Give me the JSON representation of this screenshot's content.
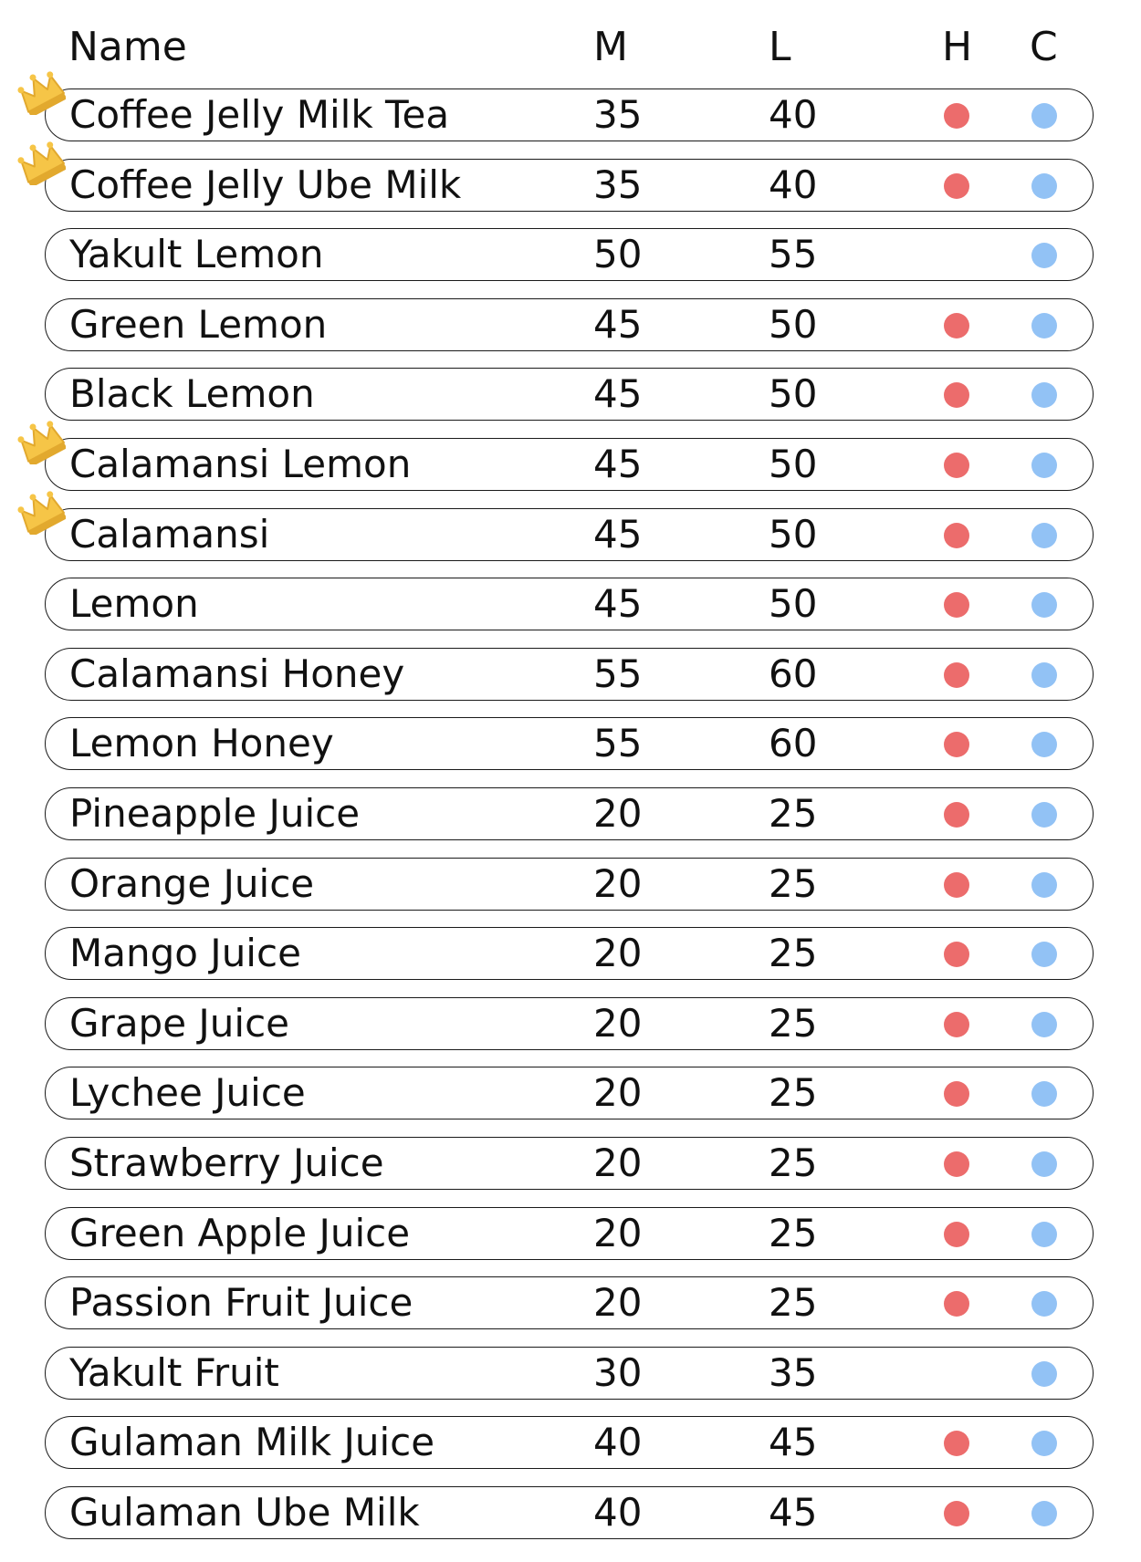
{
  "header": {
    "name": "Name",
    "medium": "M",
    "large": "L",
    "hot": "H",
    "cold": "C"
  },
  "colors": {
    "hot": "#ec6c6c",
    "cold": "#92c2f5",
    "crown": "#f6c547",
    "crown_shadow": "#e2a92e"
  },
  "icons": {
    "crown": "crown-icon",
    "hot": "hot-dot-icon",
    "cold": "cold-dot-icon"
  },
  "items": [
    {
      "name": "Coffee Jelly Milk Tea",
      "m": "35",
      "l": "40",
      "hot": true,
      "cold": true,
      "crown": true
    },
    {
      "name": "Coffee Jelly Ube Milk",
      "m": "35",
      "l": "40",
      "hot": true,
      "cold": true,
      "crown": true
    },
    {
      "name": "Yakult Lemon",
      "m": "50",
      "l": "55",
      "hot": false,
      "cold": true,
      "crown": false
    },
    {
      "name": "Green Lemon",
      "m": "45",
      "l": "50",
      "hot": true,
      "cold": true,
      "crown": false
    },
    {
      "name": "Black Lemon",
      "m": "45",
      "l": "50",
      "hot": true,
      "cold": true,
      "crown": false
    },
    {
      "name": "Calamansi Lemon",
      "m": "45",
      "l": "50",
      "hot": true,
      "cold": true,
      "crown": true
    },
    {
      "name": "Calamansi",
      "m": "45",
      "l": "50",
      "hot": true,
      "cold": true,
      "crown": true
    },
    {
      "name": "Lemon",
      "m": "45",
      "l": "50",
      "hot": true,
      "cold": true,
      "crown": false
    },
    {
      "name": "Calamansi Honey",
      "m": "55",
      "l": "60",
      "hot": true,
      "cold": true,
      "crown": false
    },
    {
      "name": "Lemon Honey",
      "m": "55",
      "l": "60",
      "hot": true,
      "cold": true,
      "crown": false
    },
    {
      "name": "Pineapple Juice",
      "m": "20",
      "l": "25",
      "hot": true,
      "cold": true,
      "crown": false
    },
    {
      "name": "Orange Juice",
      "m": "20",
      "l": "25",
      "hot": true,
      "cold": true,
      "crown": false
    },
    {
      "name": "Mango Juice",
      "m": "20",
      "l": "25",
      "hot": true,
      "cold": true,
      "crown": false
    },
    {
      "name": "Grape Juice",
      "m": "20",
      "l": "25",
      "hot": true,
      "cold": true,
      "crown": false
    },
    {
      "name": "Lychee Juice",
      "m": "20",
      "l": "25",
      "hot": true,
      "cold": true,
      "crown": false
    },
    {
      "name": "Strawberry Juice",
      "m": "20",
      "l": "25",
      "hot": true,
      "cold": true,
      "crown": false
    },
    {
      "name": "Green Apple Juice",
      "m": "20",
      "l": "25",
      "hot": true,
      "cold": true,
      "crown": false
    },
    {
      "name": "Passion Fruit Juice",
      "m": "20",
      "l": "25",
      "hot": true,
      "cold": true,
      "crown": false
    },
    {
      "name": "Yakult Fruit",
      "m": "30",
      "l": "35",
      "hot": false,
      "cold": true,
      "crown": false
    },
    {
      "name": "Gulaman Milk Juice",
      "m": "40",
      "l": "45",
      "hot": true,
      "cold": true,
      "crown": false
    },
    {
      "name": "Gulaman Ube Milk",
      "m": "40",
      "l": "45",
      "hot": true,
      "cold": true,
      "crown": false
    }
  ]
}
